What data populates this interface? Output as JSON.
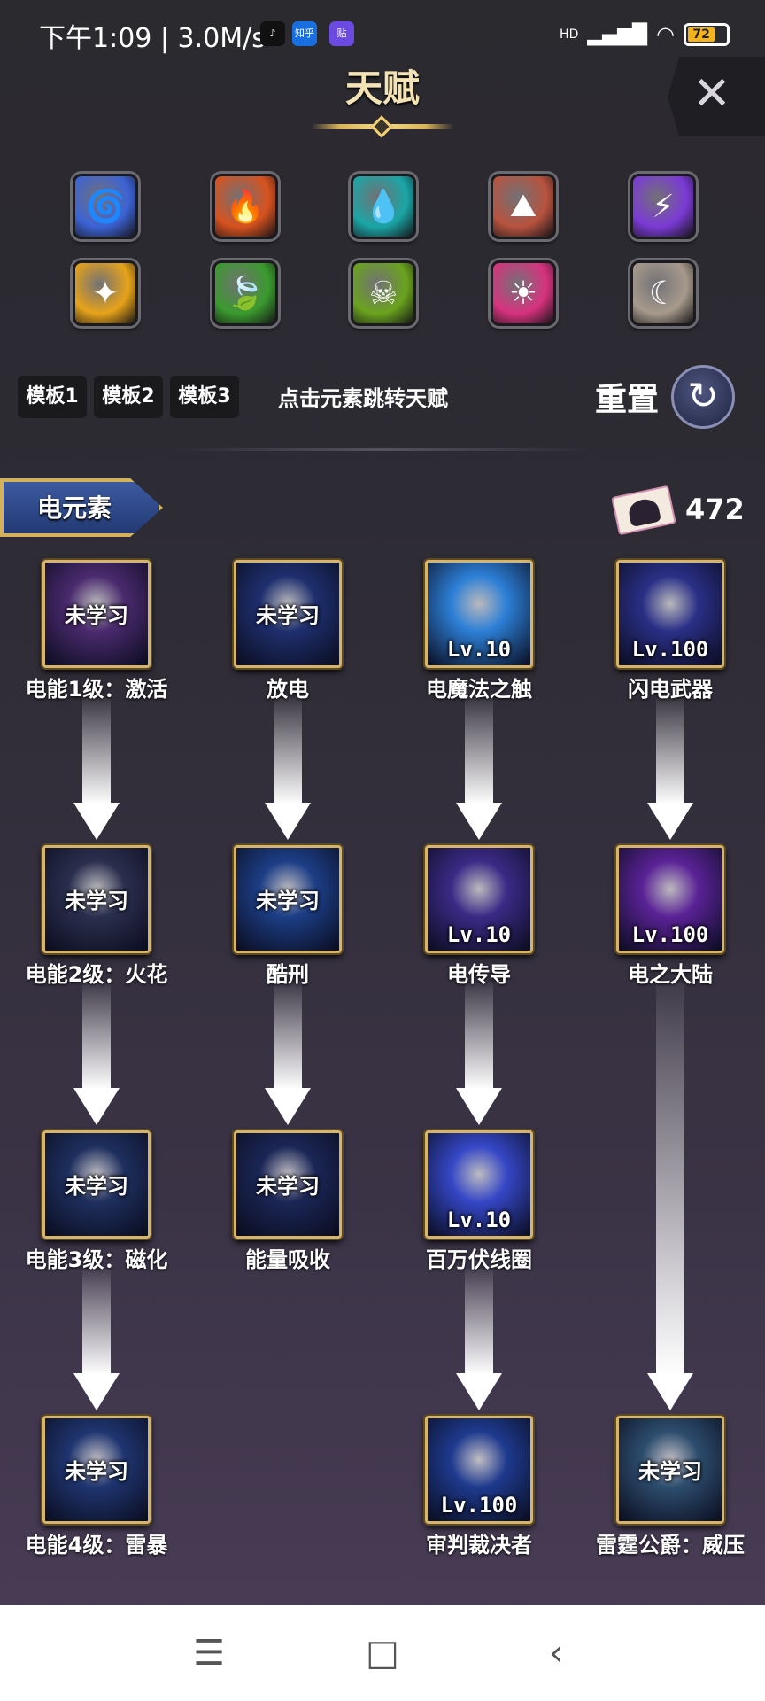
{
  "status_bar": {
    "time_speed": "下午1:09 | 3.0M/s",
    "apps": [
      "♪",
      "知乎",
      "贴"
    ],
    "signal": "HD",
    "battery": "72"
  },
  "header": {
    "title": "天赋",
    "close_label": "✕"
  },
  "elements": [
    {
      "icon": "whirlwind-icon",
      "glyph": "🌀",
      "color": "#3c63d6"
    },
    {
      "icon": "fire-icon",
      "glyph": "🔥",
      "color": "#d8521e"
    },
    {
      "icon": "water-drop-icon",
      "glyph": "💧",
      "color": "#1aa6a6"
    },
    {
      "icon": "earth-icon",
      "glyph": "⛰",
      "color": "#b8533e"
    },
    {
      "icon": "lightning-icon",
      "glyph": "⚡",
      "color": "#7b3ad6"
    },
    {
      "icon": "light-icon",
      "glyph": "✦",
      "color": "#e7a319"
    },
    {
      "icon": "leaf-icon",
      "glyph": "🍃",
      "color": "#3a9a2d"
    },
    {
      "icon": "poison-skull-icon",
      "glyph": "☠",
      "color": "#6aa31d"
    },
    {
      "icon": "sun-icon",
      "glyph": "☀",
      "color": "#d8327e"
    },
    {
      "icon": "moon-icon",
      "glyph": "☾",
      "color": "#a79a8c"
    }
  ],
  "templates": [
    "模板1",
    "模板2",
    "模板3"
  ],
  "hint": "点击元素跳转天赋",
  "reset": {
    "label": "重置",
    "icon": "↻"
  },
  "section": {
    "label": "电元素",
    "points": "472"
  },
  "talents": [
    {
      "name": "电能1级：激活",
      "state": "未学习",
      "level": "",
      "color": "#4a2a6e"
    },
    {
      "name": "放电",
      "state": "未学习",
      "level": "",
      "color": "#1e2f6e"
    },
    {
      "name": "电魔法之触",
      "state": "",
      "level": "Lv.10",
      "color": "#2c7fd6"
    },
    {
      "name": "闪电武器",
      "state": "",
      "level": "Lv.100",
      "color": "#2a2f86"
    },
    {
      "name": "电能2级：火花",
      "state": "未学习",
      "level": "",
      "color": "#2a2f4e"
    },
    {
      "name": "酷刑",
      "state": "未学习",
      "level": "",
      "color": "#1c3e86"
    },
    {
      "name": "电传导",
      "state": "",
      "level": "Lv.10",
      "color": "#3b2a86"
    },
    {
      "name": "电之大陆",
      "state": "",
      "level": "Lv.100",
      "color": "#5a2296"
    },
    {
      "name": "电能3级：磁化",
      "state": "未学习",
      "level": "",
      "color": "#1e2f5e"
    },
    {
      "name": "能量吸收",
      "state": "未学习",
      "level": "",
      "color": "#1b2656"
    },
    {
      "name": "百万伏线圈",
      "state": "",
      "level": "Lv.10",
      "color": "#3547c6"
    },
    {
      "name": "电能4级：雷暴",
      "state": "未学习",
      "level": "",
      "color": "#1f3570"
    },
    {
      "name": "审判裁决者",
      "state": "",
      "level": "Lv.100",
      "color": "#1e3a8e"
    },
    {
      "name": "雷霆公爵：威压",
      "state": "未学习",
      "level": "",
      "color": "#2d4d6e"
    }
  ],
  "nav": {
    "menu": "☰",
    "home": "□",
    "back": "‹"
  }
}
